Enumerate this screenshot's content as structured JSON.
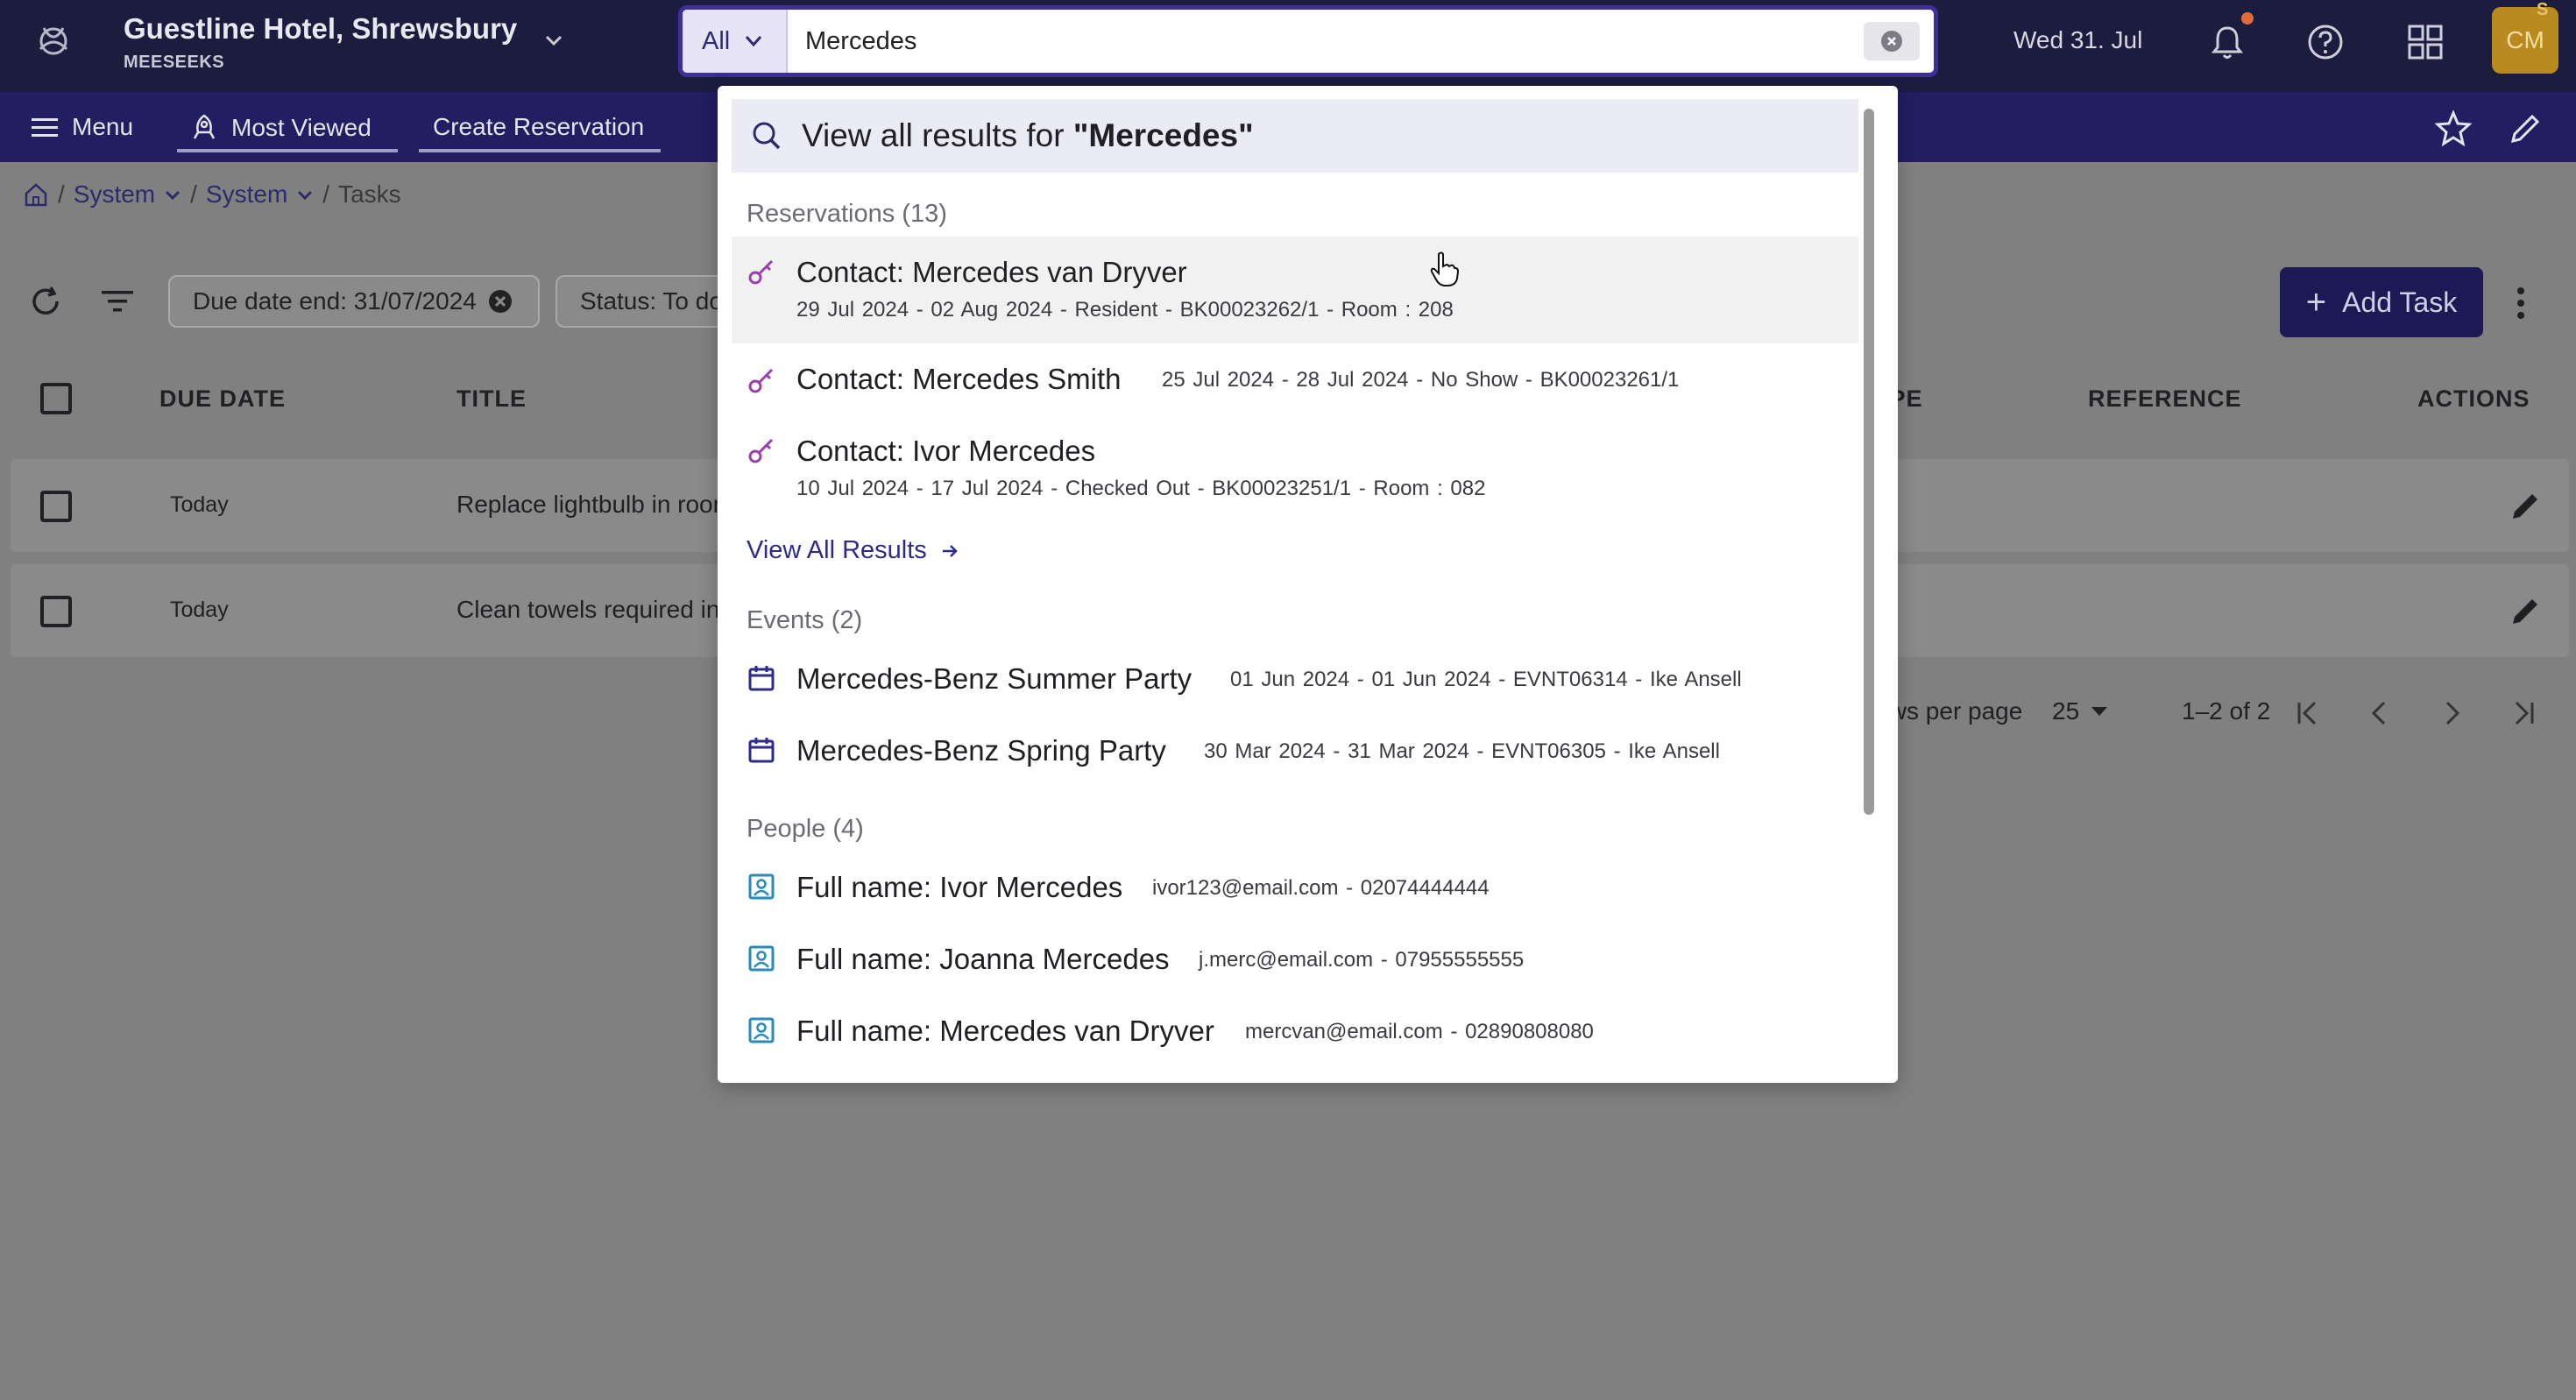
{
  "header": {
    "hotel_name": "Guestline Hotel, Shrewsbury",
    "hotel_sub": "MEESEEKS",
    "date": "Wed 31. Jul",
    "avatar_initials": "CM",
    "avatar_badge": "S",
    "icons": [
      "logo-icon",
      "bell-icon",
      "help-icon",
      "apps-grid-icon"
    ]
  },
  "nav": {
    "menu_label": "Menu",
    "most_viewed_label": "Most Viewed",
    "create_reservation_label": "Create Reservation"
  },
  "breadcrumb": {
    "items": [
      "System",
      "System",
      "Tasks"
    ]
  },
  "toolbar": {
    "chip_due_date": "Due date end: 31/07/2024",
    "chip_status": "Status: To do",
    "add_task_label": "Add Task"
  },
  "table": {
    "columns": [
      "DUE DATE",
      "TITLE",
      "TYPE",
      "REFERENCE",
      "ACTIONS"
    ],
    "rows": [
      {
        "due": "Today",
        "title": "Replace lightbulb in room"
      },
      {
        "due": "Today",
        "title": "Clean towels required in"
      }
    ]
  },
  "pager": {
    "rows_per_page_label": "Rows per page",
    "rows_per_page_value": "25",
    "range": "1–2 of 2"
  },
  "search": {
    "scope": "All",
    "query": "Mercedes",
    "view_all_prefix": "View all results for ",
    "view_all_term": "\"Mercedes\""
  },
  "results": {
    "reservations_heading": "Reservations (13)",
    "reservations": [
      {
        "title": "Contact: Mercedes van Dryver",
        "meta": "29 Jul 2024 - 02 Aug 2024  -  Resident  -  BK00023262/1  -  Room : 208"
      },
      {
        "title": "Contact: Mercedes Smith",
        "meta": "25 Jul 2024 - 28 Jul 2024  -  No Show  -  BK00023261/1"
      },
      {
        "title": "Contact: Ivor Mercedes",
        "meta": "10 Jul 2024 - 17 Jul 2024  -  Checked Out  -  BK00023251/1  -  Room : 082"
      }
    ],
    "view_all_results_label": "View All Results",
    "events_heading": "Events (2)",
    "events": [
      {
        "title": "Mercedes-Benz Summer Party",
        "meta": "01 Jun 2024 - 01 Jun 2024  -  EVNT06314  -  Ike Ansell"
      },
      {
        "title": "Mercedes-Benz Spring Party",
        "meta": "30 Mar 2024 - 31 Mar 2024  -  EVNT06305  -  Ike Ansell"
      }
    ],
    "people_heading": "People (4)",
    "people": [
      {
        "title": "Full name: Ivor Mercedes",
        "meta": "ivor123@email.com  -  02074444444"
      },
      {
        "title": "Full name: Joanna Mercedes",
        "meta": "j.merc@email.com  -  07955555555"
      },
      {
        "title": "Full name: Mercedes van Dryver",
        "meta": "mercvan@email.com  -  02890808080"
      }
    ]
  },
  "colors": {
    "topbar": "#1c1c3f",
    "navbar": "#211e61",
    "search_border": "#3d2f9a",
    "reservation_icon": "#9b3fb0",
    "event_icon": "#2e2a8c",
    "person_icon": "#2a8ab8",
    "link": "#2e2a8c"
  }
}
